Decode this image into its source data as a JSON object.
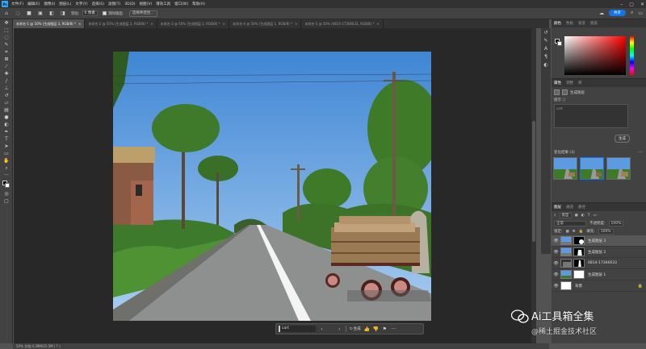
{
  "app": {
    "logo": "Ps"
  },
  "menubar": {
    "items": [
      "文件(F)",
      "编辑(E)",
      "图像(I)",
      "图层(L)",
      "文字(Y)",
      "选择(S)",
      "滤镜(T)",
      "3D(D)",
      "视图(V)",
      "增效工具",
      "窗口(W)",
      "帮助(H)"
    ]
  },
  "options": {
    "feather_label": "羽化:",
    "feather_value": "0 像素",
    "antialias_label": "消除锯齿",
    "select_subject": "选择并遮住...",
    "share_label": "共享"
  },
  "tabs": [
    {
      "label": "未命名-1 @ 50% (生成图层 3, RGB/8) *",
      "active": true
    },
    {
      "label": "未命名-2 @ 50% (生成图层 2, RGB/8) *",
      "active": false
    },
    {
      "label": "未命名-3 @ 50% (生成图层 2, RGB/8) *",
      "active": false
    },
    {
      "label": "未命名-4 @ 50% (生成图层 1, RGB/8) *",
      "active": false
    },
    {
      "label": "未命名-5 @ 50% (0814-17366633, RGB/8) *",
      "active": false
    }
  ],
  "taskbar": {
    "prompt": "cart",
    "generate": "生成"
  },
  "statusbar": {
    "text": "50%    文档:4.39M/21.5M    ( ? )"
  },
  "color_panel": {
    "tabs": [
      "颜色",
      "色板",
      "渐变",
      "图案"
    ]
  },
  "properties": {
    "tabs": [
      "属性",
      "调整",
      "库"
    ],
    "layer_type": "生成图层",
    "prompt_label": "提示 ⓘ",
    "prompt_value": "cart",
    "generate_btn": "生成",
    "variations_label": "变化结果 (3)",
    "more": "···"
  },
  "layers": {
    "tabs": [
      "图层",
      "通道",
      "路径"
    ],
    "kind_label": "类型",
    "blend_mode": "正常",
    "opacity_label": "不透明度:",
    "opacity_value": "100%",
    "lock_label": "锁定:",
    "fill_label": "填充:",
    "fill_value": "100%",
    "items": [
      {
        "name": "生成图层 3",
        "selected": true
      },
      {
        "name": "生成图层 2",
        "selected": false
      },
      {
        "name": "0814-17366633",
        "selected": false
      },
      {
        "name": "生成图层 1",
        "selected": false
      },
      {
        "name": "背景",
        "selected": false
      }
    ]
  },
  "watermark": {
    "title": "Ai工具箱全集",
    "subtitle": "@稀土掘金技术社区"
  }
}
